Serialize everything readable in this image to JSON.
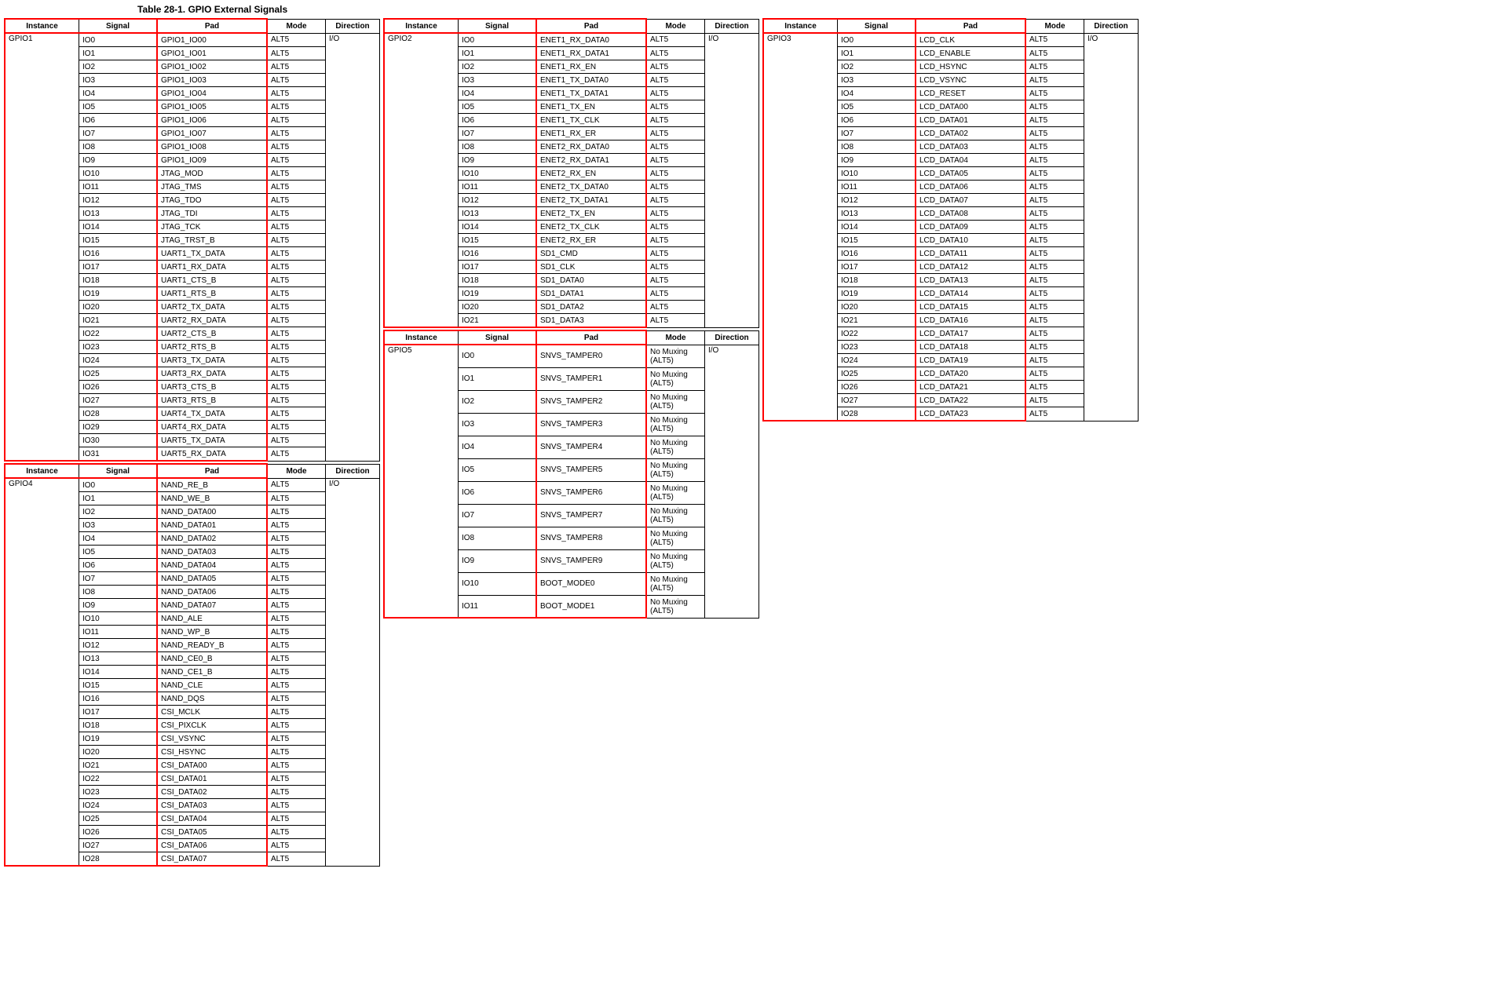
{
  "title": "Table 28-1.  GPIO External Signals",
  "headers": [
    "Instance",
    "Signal",
    "Pad",
    "Mode",
    "Direction"
  ],
  "tables": [
    {
      "instance": "GPIO1",
      "rows": [
        [
          "IO0",
          "GPIO1_IO00",
          "ALT5",
          "I/O"
        ],
        [
          "IO1",
          "GPIO1_IO01",
          "ALT5",
          ""
        ],
        [
          "IO2",
          "GPIO1_IO02",
          "ALT5",
          ""
        ],
        [
          "IO3",
          "GPIO1_IO03",
          "ALT5",
          ""
        ],
        [
          "IO4",
          "GPIO1_IO04",
          "ALT5",
          ""
        ],
        [
          "IO5",
          "GPIO1_IO05",
          "ALT5",
          ""
        ],
        [
          "IO6",
          "GPIO1_IO06",
          "ALT5",
          ""
        ],
        [
          "IO7",
          "GPIO1_IO07",
          "ALT5",
          ""
        ],
        [
          "IO8",
          "GPIO1_IO08",
          "ALT5",
          ""
        ],
        [
          "IO9",
          "GPIO1_IO09",
          "ALT5",
          ""
        ],
        [
          "IO10",
          "JTAG_MOD",
          "ALT5",
          ""
        ],
        [
          "IO11",
          "JTAG_TMS",
          "ALT5",
          ""
        ],
        [
          "IO12",
          "JTAG_TDO",
          "ALT5",
          ""
        ],
        [
          "IO13",
          "JTAG_TDI",
          "ALT5",
          ""
        ],
        [
          "IO14",
          "JTAG_TCK",
          "ALT5",
          ""
        ],
        [
          "IO15",
          "JTAG_TRST_B",
          "ALT5",
          ""
        ],
        [
          "IO16",
          "UART1_TX_DATA",
          "ALT5",
          ""
        ],
        [
          "IO17",
          "UART1_RX_DATA",
          "ALT5",
          ""
        ],
        [
          "IO18",
          "UART1_CTS_B",
          "ALT5",
          ""
        ],
        [
          "IO19",
          "UART1_RTS_B",
          "ALT5",
          ""
        ],
        [
          "IO20",
          "UART2_TX_DATA",
          "ALT5",
          ""
        ],
        [
          "IO21",
          "UART2_RX_DATA",
          "ALT5",
          ""
        ],
        [
          "IO22",
          "UART2_CTS_B",
          "ALT5",
          ""
        ],
        [
          "IO23",
          "UART2_RTS_B",
          "ALT5",
          ""
        ],
        [
          "IO24",
          "UART3_TX_DATA",
          "ALT5",
          ""
        ],
        [
          "IO25",
          "UART3_RX_DATA",
          "ALT5",
          ""
        ],
        [
          "IO26",
          "UART3_CTS_B",
          "ALT5",
          ""
        ],
        [
          "IO27",
          "UART3_RTS_B",
          "ALT5",
          ""
        ],
        [
          "IO28",
          "UART4_TX_DATA",
          "ALT5",
          ""
        ],
        [
          "IO29",
          "UART4_RX_DATA",
          "ALT5",
          ""
        ],
        [
          "IO30",
          "UART5_TX_DATA",
          "ALT5",
          ""
        ],
        [
          "IO31",
          "UART5_RX_DATA",
          "ALT5",
          ""
        ]
      ]
    },
    {
      "instance": "GPIO4",
      "rows": [
        [
          "IO0",
          "NAND_RE_B",
          "ALT5",
          "I/O"
        ],
        [
          "IO1",
          "NAND_WE_B",
          "ALT5",
          ""
        ],
        [
          "IO2",
          "NAND_DATA00",
          "ALT5",
          ""
        ],
        [
          "IO3",
          "NAND_DATA01",
          "ALT5",
          ""
        ],
        [
          "IO4",
          "NAND_DATA02",
          "ALT5",
          ""
        ],
        [
          "IO5",
          "NAND_DATA03",
          "ALT5",
          ""
        ],
        [
          "IO6",
          "NAND_DATA04",
          "ALT5",
          ""
        ],
        [
          "IO7",
          "NAND_DATA05",
          "ALT5",
          ""
        ],
        [
          "IO8",
          "NAND_DATA06",
          "ALT5",
          ""
        ],
        [
          "IO9",
          "NAND_DATA07",
          "ALT5",
          ""
        ],
        [
          "IO10",
          "NAND_ALE",
          "ALT5",
          ""
        ],
        [
          "IO11",
          "NAND_WP_B",
          "ALT5",
          ""
        ],
        [
          "IO12",
          "NAND_READY_B",
          "ALT5",
          ""
        ],
        [
          "IO13",
          "NAND_CE0_B",
          "ALT5",
          ""
        ],
        [
          "IO14",
          "NAND_CE1_B",
          "ALT5",
          ""
        ],
        [
          "IO15",
          "NAND_CLE",
          "ALT5",
          ""
        ],
        [
          "IO16",
          "NAND_DQS",
          "ALT5",
          ""
        ],
        [
          "IO17",
          "CSI_MCLK",
          "ALT5",
          ""
        ],
        [
          "IO18",
          "CSI_PIXCLK",
          "ALT5",
          ""
        ],
        [
          "IO19",
          "CSI_VSYNC",
          "ALT5",
          ""
        ],
        [
          "IO20",
          "CSI_HSYNC",
          "ALT5",
          ""
        ],
        [
          "IO21",
          "CSI_DATA00",
          "ALT5",
          ""
        ],
        [
          "IO22",
          "CSI_DATA01",
          "ALT5",
          ""
        ],
        [
          "IO23",
          "CSI_DATA02",
          "ALT5",
          ""
        ],
        [
          "IO24",
          "CSI_DATA03",
          "ALT5",
          ""
        ],
        [
          "IO25",
          "CSI_DATA04",
          "ALT5",
          ""
        ],
        [
          "IO26",
          "CSI_DATA05",
          "ALT5",
          ""
        ],
        [
          "IO27",
          "CSI_DATA06",
          "ALT5",
          ""
        ],
        [
          "IO28",
          "CSI_DATA07",
          "ALT5",
          ""
        ]
      ]
    },
    {
      "instance": "GPIO2",
      "rows": [
        [
          "IO0",
          "ENET1_RX_DATA0",
          "ALT5",
          "I/O"
        ],
        [
          "IO1",
          "ENET1_RX_DATA1",
          "ALT5",
          ""
        ],
        [
          "IO2",
          "ENET1_RX_EN",
          "ALT5",
          ""
        ],
        [
          "IO3",
          "ENET1_TX_DATA0",
          "ALT5",
          ""
        ],
        [
          "IO4",
          "ENET1_TX_DATA1",
          "ALT5",
          ""
        ],
        [
          "IO5",
          "ENET1_TX_EN",
          "ALT5",
          ""
        ],
        [
          "IO6",
          "ENET1_TX_CLK",
          "ALT5",
          ""
        ],
        [
          "IO7",
          "ENET1_RX_ER",
          "ALT5",
          ""
        ],
        [
          "IO8",
          "ENET2_RX_DATA0",
          "ALT5",
          ""
        ],
        [
          "IO9",
          "ENET2_RX_DATA1",
          "ALT5",
          ""
        ],
        [
          "IO10",
          "ENET2_RX_EN",
          "ALT5",
          ""
        ],
        [
          "IO11",
          "ENET2_TX_DATA0",
          "ALT5",
          ""
        ],
        [
          "IO12",
          "ENET2_TX_DATA1",
          "ALT5",
          ""
        ],
        [
          "IO13",
          "ENET2_TX_EN",
          "ALT5",
          ""
        ],
        [
          "IO14",
          "ENET2_TX_CLK",
          "ALT5",
          ""
        ],
        [
          "IO15",
          "ENET2_RX_ER",
          "ALT5",
          ""
        ],
        [
          "IO16",
          "SD1_CMD",
          "ALT5",
          ""
        ],
        [
          "IO17",
          "SD1_CLK",
          "ALT5",
          ""
        ],
        [
          "IO18",
          "SD1_DATA0",
          "ALT5",
          ""
        ],
        [
          "IO19",
          "SD1_DATA1",
          "ALT5",
          ""
        ],
        [
          "IO20",
          "SD1_DATA2",
          "ALT5",
          ""
        ],
        [
          "IO21",
          "SD1_DATA3",
          "ALT5",
          ""
        ]
      ]
    },
    {
      "instance": "GPIO5",
      "rows": [
        [
          "IO0",
          "SNVS_TAMPER0",
          "No Muxing (ALT5)",
          "I/O"
        ],
        [
          "IO1",
          "SNVS_TAMPER1",
          "No Muxing (ALT5)",
          ""
        ],
        [
          "IO2",
          "SNVS_TAMPER2",
          "No Muxing (ALT5)",
          ""
        ],
        [
          "IO3",
          "SNVS_TAMPER3",
          "No Muxing (ALT5)",
          ""
        ],
        [
          "IO4",
          "SNVS_TAMPER4",
          "No Muxing (ALT5)",
          ""
        ],
        [
          "IO5",
          "SNVS_TAMPER5",
          "No Muxing (ALT5)",
          ""
        ],
        [
          "IO6",
          "SNVS_TAMPER6",
          "No Muxing (ALT5)",
          ""
        ],
        [
          "IO7",
          "SNVS_TAMPER7",
          "No Muxing (ALT5)",
          ""
        ],
        [
          "IO8",
          "SNVS_TAMPER8",
          "No Muxing (ALT5)",
          ""
        ],
        [
          "IO9",
          "SNVS_TAMPER9",
          "No Muxing (ALT5)",
          ""
        ],
        [
          "IO10",
          "BOOT_MODE0",
          "No Muxing (ALT5)",
          ""
        ],
        [
          "IO11",
          "BOOT_MODE1",
          "No Muxing (ALT5)",
          ""
        ]
      ],
      "tallMode": true
    },
    {
      "instance": "GPIO3",
      "rows": [
        [
          "IO0",
          "LCD_CLK",
          "ALT5",
          "I/O"
        ],
        [
          "IO1",
          "LCD_ENABLE",
          "ALT5",
          ""
        ],
        [
          "IO2",
          "LCD_HSYNC",
          "ALT5",
          ""
        ],
        [
          "IO3",
          "LCD_VSYNC",
          "ALT5",
          ""
        ],
        [
          "IO4",
          "LCD_RESET",
          "ALT5",
          ""
        ],
        [
          "IO5",
          "LCD_DATA00",
          "ALT5",
          ""
        ],
        [
          "IO6",
          "LCD_DATA01",
          "ALT5",
          ""
        ],
        [
          "IO7",
          "LCD_DATA02",
          "ALT5",
          ""
        ],
        [
          "IO8",
          "LCD_DATA03",
          "ALT5",
          ""
        ],
        [
          "IO9",
          "LCD_DATA04",
          "ALT5",
          ""
        ],
        [
          "IO10",
          "LCD_DATA05",
          "ALT5",
          ""
        ],
        [
          "IO11",
          "LCD_DATA06",
          "ALT5",
          ""
        ],
        [
          "IO12",
          "LCD_DATA07",
          "ALT5",
          ""
        ],
        [
          "IO13",
          "LCD_DATA08",
          "ALT5",
          ""
        ],
        [
          "IO14",
          "LCD_DATA09",
          "ALT5",
          ""
        ],
        [
          "IO15",
          "LCD_DATA10",
          "ALT5",
          ""
        ],
        [
          "IO16",
          "LCD_DATA11",
          "ALT5",
          ""
        ],
        [
          "IO17",
          "LCD_DATA12",
          "ALT5",
          ""
        ],
        [
          "IO18",
          "LCD_DATA13",
          "ALT5",
          ""
        ],
        [
          "IO19",
          "LCD_DATA14",
          "ALT5",
          ""
        ],
        [
          "IO20",
          "LCD_DATA15",
          "ALT5",
          ""
        ],
        [
          "IO21",
          "LCD_DATA16",
          "ALT5",
          ""
        ],
        [
          "IO22",
          "LCD_DATA17",
          "ALT5",
          ""
        ],
        [
          "IO23",
          "LCD_DATA18",
          "ALT5",
          ""
        ],
        [
          "IO24",
          "LCD_DATA19",
          "ALT5",
          ""
        ],
        [
          "IO25",
          "LCD_DATA20",
          "ALT5",
          ""
        ],
        [
          "IO26",
          "LCD_DATA21",
          "ALT5",
          ""
        ],
        [
          "IO27",
          "LCD_DATA22",
          "ALT5",
          ""
        ],
        [
          "IO28",
          "LCD_DATA23",
          "ALT5",
          ""
        ]
      ]
    }
  ],
  "layout": {
    "columns": [
      [
        0,
        1
      ],
      [
        2,
        3
      ],
      [
        4
      ]
    ]
  },
  "highlight_color": "#ff0000"
}
